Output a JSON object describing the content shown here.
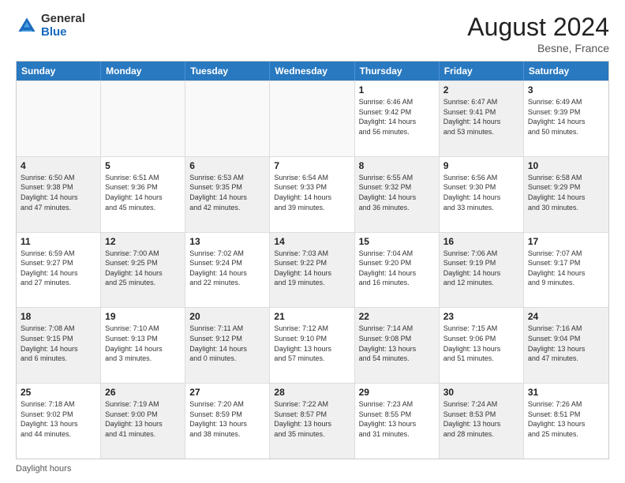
{
  "header": {
    "logo_general": "General",
    "logo_blue": "Blue",
    "month_year": "August 2024",
    "location": "Besne, France"
  },
  "footer": {
    "daylight_label": "Daylight hours"
  },
  "days_of_week": [
    "Sunday",
    "Monday",
    "Tuesday",
    "Wednesday",
    "Thursday",
    "Friday",
    "Saturday"
  ],
  "weeks": [
    [
      {
        "day": "",
        "info": "",
        "shaded": false,
        "empty": true
      },
      {
        "day": "",
        "info": "",
        "shaded": false,
        "empty": true
      },
      {
        "day": "",
        "info": "",
        "shaded": false,
        "empty": true
      },
      {
        "day": "",
        "info": "",
        "shaded": false,
        "empty": true
      },
      {
        "day": "1",
        "info": "Sunrise: 6:46 AM\nSunset: 9:42 PM\nDaylight: 14 hours\nand 56 minutes.",
        "shaded": false,
        "empty": false
      },
      {
        "day": "2",
        "info": "Sunrise: 6:47 AM\nSunset: 9:41 PM\nDaylight: 14 hours\nand 53 minutes.",
        "shaded": true,
        "empty": false
      },
      {
        "day": "3",
        "info": "Sunrise: 6:49 AM\nSunset: 9:39 PM\nDaylight: 14 hours\nand 50 minutes.",
        "shaded": false,
        "empty": false
      }
    ],
    [
      {
        "day": "4",
        "info": "Sunrise: 6:50 AM\nSunset: 9:38 PM\nDaylight: 14 hours\nand 47 minutes.",
        "shaded": true,
        "empty": false
      },
      {
        "day": "5",
        "info": "Sunrise: 6:51 AM\nSunset: 9:36 PM\nDaylight: 14 hours\nand 45 minutes.",
        "shaded": false,
        "empty": false
      },
      {
        "day": "6",
        "info": "Sunrise: 6:53 AM\nSunset: 9:35 PM\nDaylight: 14 hours\nand 42 minutes.",
        "shaded": true,
        "empty": false
      },
      {
        "day": "7",
        "info": "Sunrise: 6:54 AM\nSunset: 9:33 PM\nDaylight: 14 hours\nand 39 minutes.",
        "shaded": false,
        "empty": false
      },
      {
        "day": "8",
        "info": "Sunrise: 6:55 AM\nSunset: 9:32 PM\nDaylight: 14 hours\nand 36 minutes.",
        "shaded": true,
        "empty": false
      },
      {
        "day": "9",
        "info": "Sunrise: 6:56 AM\nSunset: 9:30 PM\nDaylight: 14 hours\nand 33 minutes.",
        "shaded": false,
        "empty": false
      },
      {
        "day": "10",
        "info": "Sunrise: 6:58 AM\nSunset: 9:29 PM\nDaylight: 14 hours\nand 30 minutes.",
        "shaded": true,
        "empty": false
      }
    ],
    [
      {
        "day": "11",
        "info": "Sunrise: 6:59 AM\nSunset: 9:27 PM\nDaylight: 14 hours\nand 27 minutes.",
        "shaded": false,
        "empty": false
      },
      {
        "day": "12",
        "info": "Sunrise: 7:00 AM\nSunset: 9:25 PM\nDaylight: 14 hours\nand 25 minutes.",
        "shaded": true,
        "empty": false
      },
      {
        "day": "13",
        "info": "Sunrise: 7:02 AM\nSunset: 9:24 PM\nDaylight: 14 hours\nand 22 minutes.",
        "shaded": false,
        "empty": false
      },
      {
        "day": "14",
        "info": "Sunrise: 7:03 AM\nSunset: 9:22 PM\nDaylight: 14 hours\nand 19 minutes.",
        "shaded": true,
        "empty": false
      },
      {
        "day": "15",
        "info": "Sunrise: 7:04 AM\nSunset: 9:20 PM\nDaylight: 14 hours\nand 16 minutes.",
        "shaded": false,
        "empty": false
      },
      {
        "day": "16",
        "info": "Sunrise: 7:06 AM\nSunset: 9:19 PM\nDaylight: 14 hours\nand 12 minutes.",
        "shaded": true,
        "empty": false
      },
      {
        "day": "17",
        "info": "Sunrise: 7:07 AM\nSunset: 9:17 PM\nDaylight: 14 hours\nand 9 minutes.",
        "shaded": false,
        "empty": false
      }
    ],
    [
      {
        "day": "18",
        "info": "Sunrise: 7:08 AM\nSunset: 9:15 PM\nDaylight: 14 hours\nand 6 minutes.",
        "shaded": true,
        "empty": false
      },
      {
        "day": "19",
        "info": "Sunrise: 7:10 AM\nSunset: 9:13 PM\nDaylight: 14 hours\nand 3 minutes.",
        "shaded": false,
        "empty": false
      },
      {
        "day": "20",
        "info": "Sunrise: 7:11 AM\nSunset: 9:12 PM\nDaylight: 14 hours\nand 0 minutes.",
        "shaded": true,
        "empty": false
      },
      {
        "day": "21",
        "info": "Sunrise: 7:12 AM\nSunset: 9:10 PM\nDaylight: 13 hours\nand 57 minutes.",
        "shaded": false,
        "empty": false
      },
      {
        "day": "22",
        "info": "Sunrise: 7:14 AM\nSunset: 9:08 PM\nDaylight: 13 hours\nand 54 minutes.",
        "shaded": true,
        "empty": false
      },
      {
        "day": "23",
        "info": "Sunrise: 7:15 AM\nSunset: 9:06 PM\nDaylight: 13 hours\nand 51 minutes.",
        "shaded": false,
        "empty": false
      },
      {
        "day": "24",
        "info": "Sunrise: 7:16 AM\nSunset: 9:04 PM\nDaylight: 13 hours\nand 47 minutes.",
        "shaded": true,
        "empty": false
      }
    ],
    [
      {
        "day": "25",
        "info": "Sunrise: 7:18 AM\nSunset: 9:02 PM\nDaylight: 13 hours\nand 44 minutes.",
        "shaded": false,
        "empty": false
      },
      {
        "day": "26",
        "info": "Sunrise: 7:19 AM\nSunset: 9:00 PM\nDaylight: 13 hours\nand 41 minutes.",
        "shaded": true,
        "empty": false
      },
      {
        "day": "27",
        "info": "Sunrise: 7:20 AM\nSunset: 8:59 PM\nDaylight: 13 hours\nand 38 minutes.",
        "shaded": false,
        "empty": false
      },
      {
        "day": "28",
        "info": "Sunrise: 7:22 AM\nSunset: 8:57 PM\nDaylight: 13 hours\nand 35 minutes.",
        "shaded": true,
        "empty": false
      },
      {
        "day": "29",
        "info": "Sunrise: 7:23 AM\nSunset: 8:55 PM\nDaylight: 13 hours\nand 31 minutes.",
        "shaded": false,
        "empty": false
      },
      {
        "day": "30",
        "info": "Sunrise: 7:24 AM\nSunset: 8:53 PM\nDaylight: 13 hours\nand 28 minutes.",
        "shaded": true,
        "empty": false
      },
      {
        "day": "31",
        "info": "Sunrise: 7:26 AM\nSunset: 8:51 PM\nDaylight: 13 hours\nand 25 minutes.",
        "shaded": false,
        "empty": false
      }
    ]
  ]
}
